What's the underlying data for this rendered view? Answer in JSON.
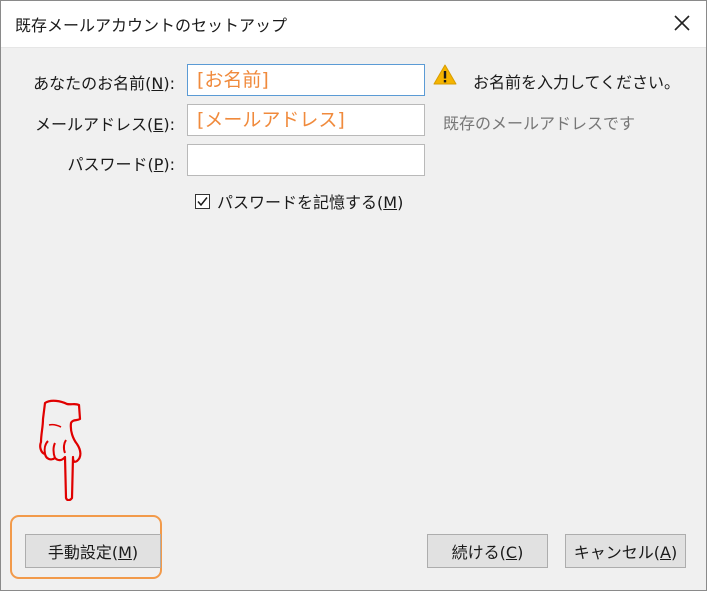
{
  "window": {
    "title": "既存メールアカウントのセットアップ",
    "close_icon": "close-icon"
  },
  "form": {
    "name_label": "あなたのお名前(",
    "name_key": "N",
    "name_suffix": "):",
    "name_value": "[お名前]",
    "name_warning": "お名前を入力してください。",
    "warning_icon": "warning-icon",
    "email_label": "メールアドレス(",
    "email_key": "E",
    "email_suffix": "):",
    "email_value": "[メールアドレス]",
    "email_hint": "既存のメールアドレスです",
    "password_label": "パスワード(",
    "password_key": "P",
    "password_suffix": "):",
    "password_value": "",
    "remember_label": "パスワードを記憶する(",
    "remember_key": "M",
    "remember_suffix": ")",
    "remember_checked": true
  },
  "buttons": {
    "manual_label": "手動設定(",
    "manual_key": "M",
    "manual_suffix": ")",
    "continue_label": "続ける(",
    "continue_key": "C",
    "continue_suffix": ")",
    "cancel_label": "キャンセル(",
    "cancel_key": "A",
    "cancel_suffix": ")"
  },
  "annotation": {
    "pointer_icon": "pointing-hand-icon",
    "highlight_color": "#f29a4a",
    "pointer_color": "#e00000"
  },
  "colors": {
    "value_text": "#f08a3c",
    "warning": "#f5b400"
  }
}
